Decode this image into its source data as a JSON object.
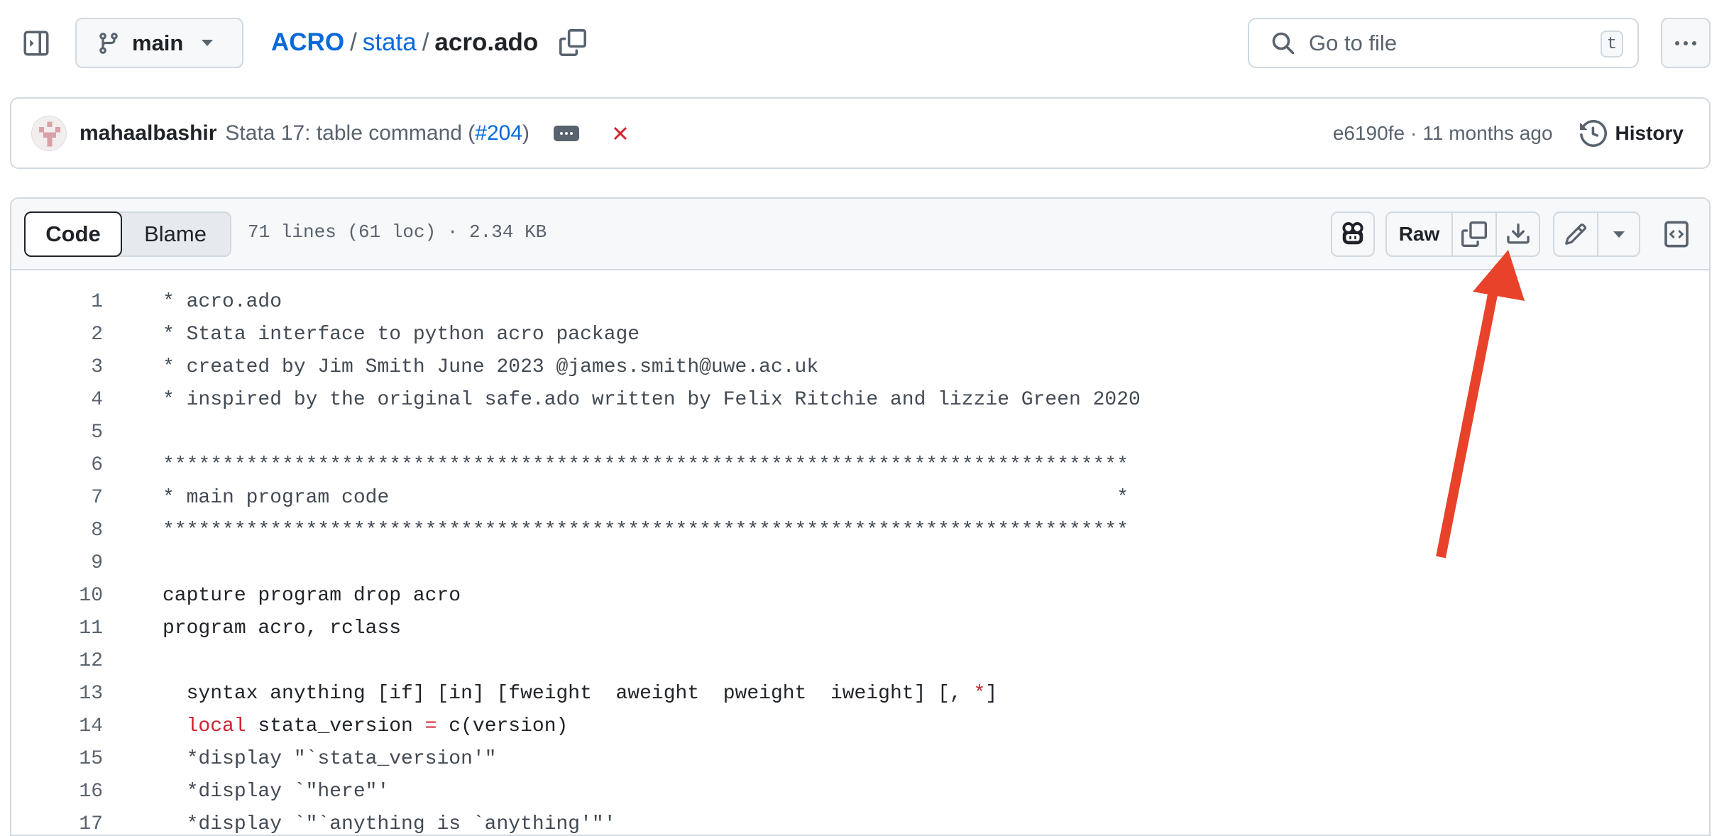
{
  "header": {
    "branch": "main",
    "breadcrumb": {
      "repo": "ACRO",
      "folder": "stata",
      "file": "acro.ado",
      "separator": "/"
    },
    "search_placeholder": "Go to file",
    "search_shortcut": "t"
  },
  "commit": {
    "author": "mahaalbashir",
    "message": "Stata 17: table command (",
    "pr": "#204",
    "message_end": ")",
    "status": "failed",
    "sha": "e6190fe",
    "dot": "·",
    "age": "11 months ago",
    "history_label": "History"
  },
  "file": {
    "tabs": [
      {
        "label": "Code",
        "active": true
      },
      {
        "label": "Blame",
        "active": false
      }
    ],
    "info": "71 lines (61 loc) · 2.34 KB",
    "raw_label": "Raw",
    "lines": [
      {
        "n": "1",
        "segs": [
          [
            "* acro.ado",
            "c"
          ]
        ]
      },
      {
        "n": "2",
        "segs": [
          [
            "* Stata interface to python acro package",
            "c"
          ]
        ]
      },
      {
        "n": "3",
        "segs": [
          [
            "* created by Jim Smith June 2023 @james.smith@uwe.ac.uk",
            "c"
          ]
        ]
      },
      {
        "n": "4",
        "segs": [
          [
            "* inspired by the original safe.ado written by Felix Ritchie and lizzie Green 2020",
            "c"
          ]
        ]
      },
      {
        "n": "5",
        "segs": []
      },
      {
        "n": "6",
        "segs": [
          [
            "*********************************************************************************",
            "c"
          ]
        ]
      },
      {
        "n": "7",
        "segs": [
          [
            "* main program code                                                             *",
            "c"
          ]
        ]
      },
      {
        "n": "8",
        "segs": [
          [
            "*********************************************************************************",
            "c"
          ]
        ]
      },
      {
        "n": "9",
        "segs": []
      },
      {
        "n": "10",
        "segs": [
          [
            "capture program drop acro",
            ""
          ]
        ]
      },
      {
        "n": "11",
        "segs": [
          [
            "program acro, rclass",
            ""
          ]
        ]
      },
      {
        "n": "12",
        "segs": []
      },
      {
        "n": "13",
        "segs": [
          [
            "  syntax anything [if] [in] [fweight  aweight  pweight  iweight] [, ",
            ""
          ],
          [
            "*",
            "k"
          ],
          [
            "]",
            ""
          ]
        ]
      },
      {
        "n": "14",
        "segs": [
          [
            "  ",
            ""
          ],
          [
            "local",
            "k"
          ],
          [
            " stata_version ",
            ""
          ],
          [
            "=",
            "k"
          ],
          [
            " c(version)",
            ""
          ]
        ]
      },
      {
        "n": "15",
        "segs": [
          [
            "  *display \"`stata_version'\"",
            "c"
          ]
        ]
      },
      {
        "n": "16",
        "segs": [
          [
            "  *display `\"here\"'",
            "c"
          ]
        ]
      },
      {
        "n": "17",
        "segs": [
          [
            "  *display `\"`anything is `anything'\"'",
            "c"
          ]
        ]
      }
    ]
  },
  "annotation": {
    "arrow_color": "#e8432a",
    "points_to": "download-button"
  },
  "colors": {
    "link": "#0969da",
    "error": "#d1242f",
    "border": "#d1d9e0"
  }
}
